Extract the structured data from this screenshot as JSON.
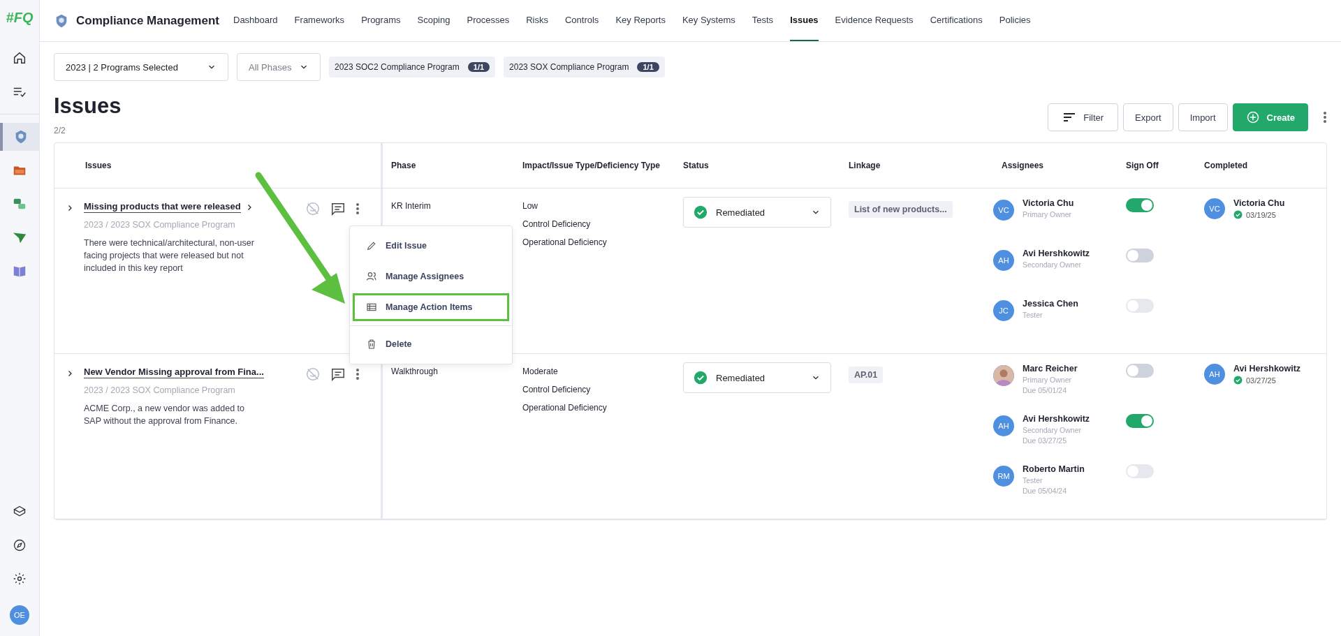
{
  "app": {
    "logo": "#FQ",
    "title": "Compliance Management"
  },
  "sidebar": {
    "items": [
      {
        "selected": false
      },
      {
        "selected": false
      },
      {
        "selected": true
      },
      {
        "selected": false
      },
      {
        "selected": false
      },
      {
        "selected": false
      },
      {
        "selected": false
      }
    ],
    "user_initials": "OE"
  },
  "nav": [
    {
      "label": "Dashboard",
      "selected": false
    },
    {
      "label": "Frameworks",
      "selected": false
    },
    {
      "label": "Programs",
      "selected": false
    },
    {
      "label": "Scoping",
      "selected": false
    },
    {
      "label": "Processes",
      "selected": false
    },
    {
      "label": "Risks",
      "selected": false
    },
    {
      "label": "Controls",
      "selected": false
    },
    {
      "label": "Key Reports",
      "selected": false
    },
    {
      "label": "Key Systems",
      "selected": false
    },
    {
      "label": "Tests",
      "selected": false
    },
    {
      "label": "Issues",
      "selected": true
    },
    {
      "label": "Evidence Requests",
      "selected": false
    },
    {
      "label": "Certifications",
      "selected": false
    },
    {
      "label": "Policies",
      "selected": false
    }
  ],
  "filters": {
    "program_select": "2023 | 2 Programs Selected",
    "phase_select": "All Phases",
    "chips": [
      {
        "label": "2023 SOC2 Compliance Program",
        "count": "1/1"
      },
      {
        "label": "2023 SOX Compliance Program",
        "count": "1/1"
      }
    ]
  },
  "page": {
    "title": "Issues",
    "count": "2/2",
    "buttons": [
      {
        "label": "Filter",
        "kind": "filter"
      },
      {
        "label": "Export",
        "kind": "plain"
      },
      {
        "label": "Import",
        "kind": "plain"
      },
      {
        "label": "Create",
        "kind": "primary"
      }
    ]
  },
  "table": {
    "columns": [
      "Issues",
      "Phase",
      "Impact/Issue Type/Deficiency Type",
      "Status",
      "Linkage",
      "Assignees",
      "Sign Off",
      "Completed"
    ],
    "rows": [
      {
        "title": "Missing products that were released",
        "program": "2023 / 2023 SOX Compliance Program",
        "description": "There were technical/architectural, non-user facing projects that were released but not included in this key report",
        "phase": "KR Interim",
        "impacts": [
          "Low",
          "Control Deficiency",
          "Operational Deficiency"
        ],
        "status": "Remediated",
        "linkage": "List of new products...",
        "assignees": [
          {
            "initials": "VC",
            "name": "Victoria Chu",
            "role": "Primary Owner",
            "sign_off": {
              "on": true,
              "disabled": false
            }
          },
          {
            "initials": "AH",
            "name": "Avi Hershkowitz",
            "role": "Secondary Owner",
            "sign_off": {
              "on": false,
              "disabled": false
            }
          },
          {
            "initials": "JC",
            "name": "Jessica Chen",
            "role": "Tester",
            "sign_off": {
              "on": false,
              "disabled": true
            }
          }
        ],
        "completed": {
          "initials": "VC",
          "name": "Victoria Chu",
          "date": "03/19/25"
        }
      },
      {
        "title": "New Vendor Missing approval from Fina...",
        "program": "2023 / 2023 SOX Compliance Program",
        "description": "ACME Corp., a new vendor was added to SAP without the approval from Finance.",
        "phase": "Walkthrough",
        "impacts": [
          "Moderate",
          "Control Deficiency",
          "Operational Deficiency"
        ],
        "status": "Remediated",
        "linkage": "AP.01",
        "assignees": [
          {
            "name": "Marc Reicher",
            "role": "Primary Owner",
            "due": "Due 05/01/24",
            "sign_off": {
              "on": false,
              "disabled": false
            }
          },
          {
            "initials": "AH",
            "name": "Avi Hershkowitz",
            "role": "Secondary Owner",
            "due": "Due 03/27/25",
            "sign_off": {
              "on": true,
              "disabled": false
            }
          },
          {
            "initials": "RM",
            "name": "Roberto Martin",
            "role": "Tester",
            "due": "Due 05/04/24",
            "sign_off": {
              "on": false,
              "disabled": true
            }
          }
        ],
        "completed": {
          "initials": "AH",
          "name": "Avi Hershkowitz",
          "date": "03/27/25"
        }
      }
    ]
  },
  "row_menu": {
    "items": [
      {
        "label": "Edit Issue",
        "highlighted": false
      },
      {
        "label": "Manage Assignees",
        "highlighted": false
      },
      {
        "label": "Manage Action Items",
        "highlighted": true
      },
      {
        "label": "Delete",
        "highlighted": false
      }
    ]
  }
}
